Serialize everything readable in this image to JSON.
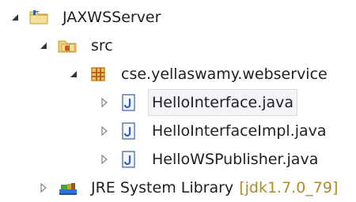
{
  "tree": {
    "items": [
      {
        "label": "JAXWSServer",
        "icon": "project-folder-icon",
        "expanded": true
      },
      {
        "label": "src",
        "icon": "source-folder-icon",
        "expanded": true
      },
      {
        "label": "cse.yellaswamy.webservice",
        "icon": "package-icon",
        "expanded": true
      },
      {
        "label": "HelloInterface.java",
        "icon": "java-file-icon",
        "expanded": false,
        "selected": true
      },
      {
        "label": "HelloInterfaceImpl.java",
        "icon": "java-file-icon",
        "expanded": false
      },
      {
        "label": "HelloWSPublisher.java",
        "icon": "java-file-icon",
        "expanded": false
      },
      {
        "label": "JRE System Library",
        "decoration": "[jdk1.7.0_79]",
        "icon": "library-icon",
        "expanded": false
      }
    ]
  },
  "colors": {
    "decoration": "#b08a2e",
    "selection_fill": "#f2f4f7",
    "selection_border": "#d9dde3"
  }
}
